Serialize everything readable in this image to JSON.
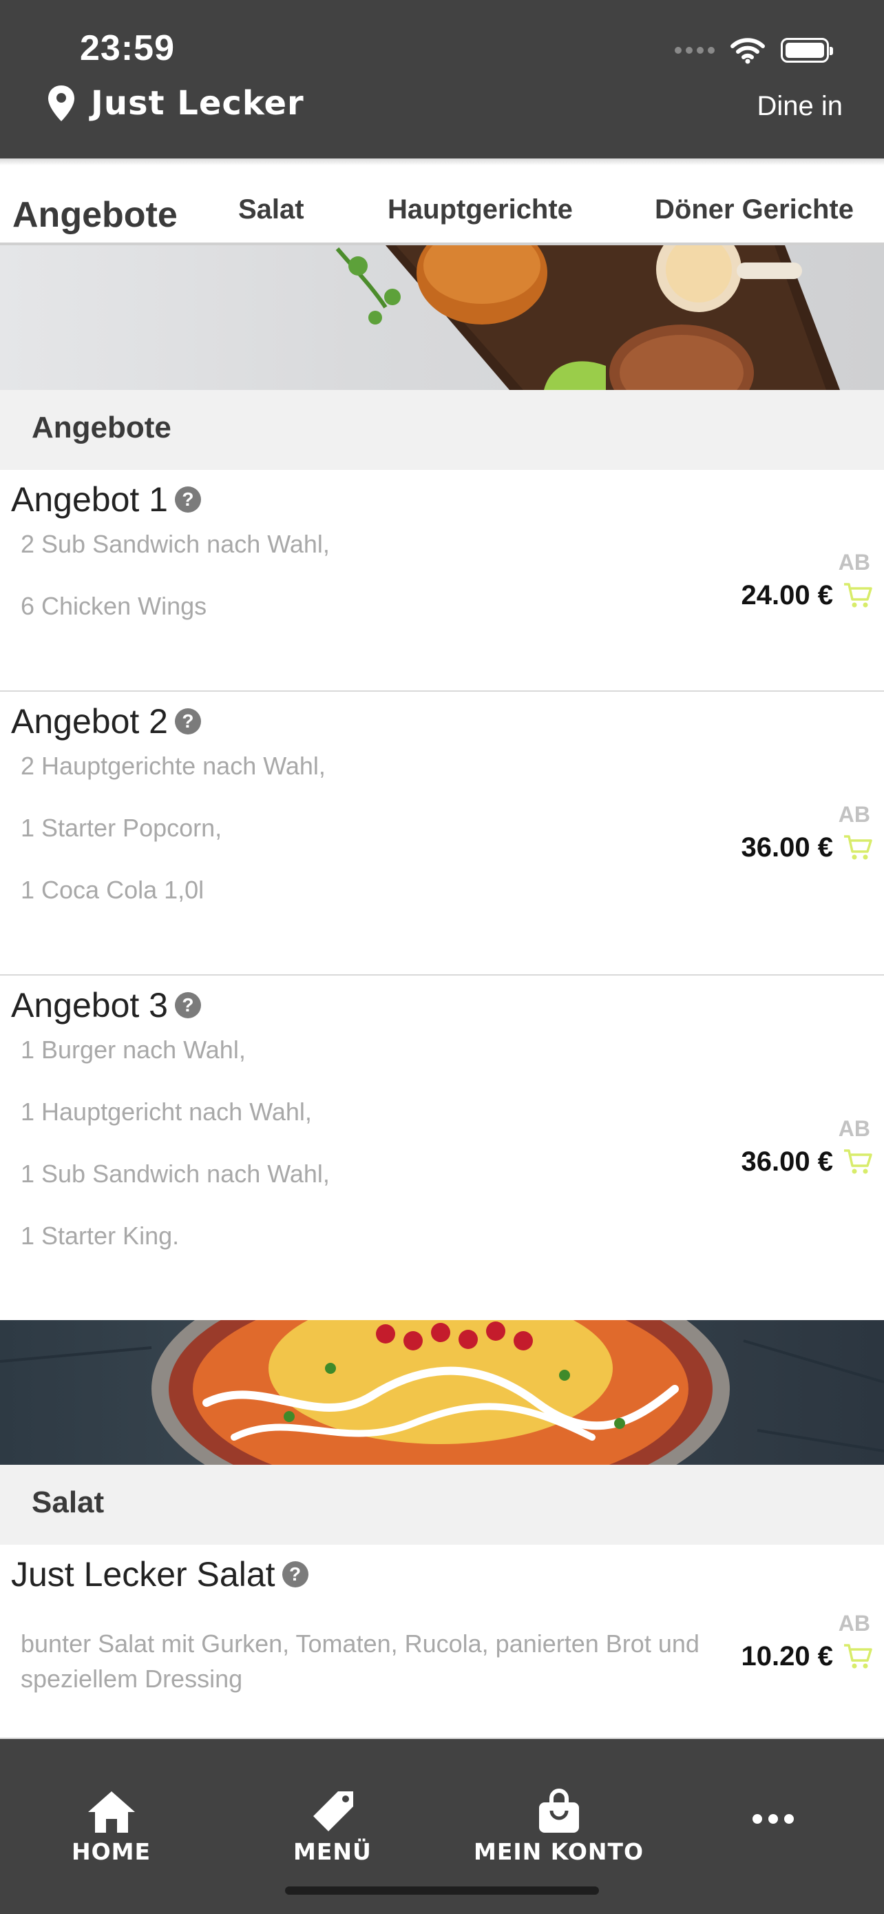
{
  "status_bar": {
    "time": "23:59"
  },
  "header": {
    "store_name": "Just Lecker",
    "mode": "Dine in"
  },
  "tabs": [
    {
      "label": "Angebote",
      "active": true
    },
    {
      "label": "Salat",
      "active": false
    },
    {
      "label": "Hauptgerichte",
      "active": false
    },
    {
      "label": "Döner Gerichte",
      "active": false
    }
  ],
  "sections": [
    {
      "title": "Angebote",
      "items": [
        {
          "name": "Angebot 1",
          "desc": [
            "2 Sub Sandwich nach Wahl,",
            "6 Chicken Wings"
          ],
          "ab": "AB",
          "price": "24.00 €"
        },
        {
          "name": "Angebot 2",
          "desc": [
            "2 Hauptgerichte nach Wahl,",
            "1 Starter Popcorn,",
            "1 Coca Cola 1,0l"
          ],
          "ab": "AB",
          "price": "36.00 €"
        },
        {
          "name": "Angebot 3",
          "desc": [
            "1 Burger nach Wahl,",
            "1 Hauptgericht nach Wahl,",
            "1 Sub Sandwich nach Wahl,",
            "1 Starter King."
          ],
          "ab": "AB",
          "price": "36.00 €"
        }
      ]
    },
    {
      "title": "Salat",
      "items": [
        {
          "name": "Just Lecker Salat",
          "desc": [
            "bunter Salat mit Gurken, Tomaten, Rucola, panierten Brot und speziellem Dressing"
          ],
          "ab": "AB",
          "price": "10.20 €"
        }
      ]
    }
  ],
  "bottom_nav": [
    {
      "label": "HOME",
      "icon": "home-icon"
    },
    {
      "label": "MENÜ",
      "icon": "tag-icon"
    },
    {
      "label": "MEIN KONTO",
      "icon": "shopping-bag-icon"
    },
    {
      "label": "",
      "icon": "more-icon"
    }
  ],
  "colors": {
    "header_bg": "#424242",
    "cart_accent": "#d8ec6a",
    "section_bg": "#f1f1f1"
  }
}
